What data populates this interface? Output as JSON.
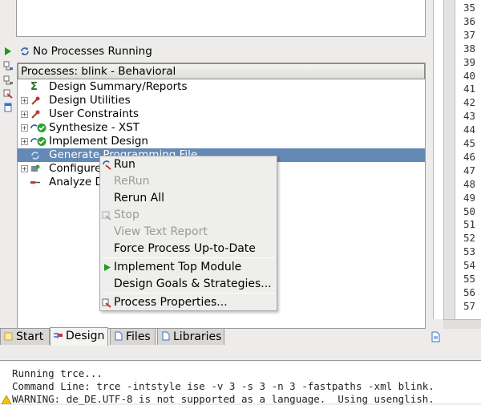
{
  "status": {
    "text": "No Processes Running"
  },
  "processes": {
    "header": "Processes: blink - Behavioral",
    "items": [
      {
        "label": "Design Summary/Reports"
      },
      {
        "label": "Design Utilities"
      },
      {
        "label": "User Constraints"
      },
      {
        "label": "Synthesize - XST"
      },
      {
        "label": "Implement Design"
      },
      {
        "label": "Generate Programming File"
      },
      {
        "label": "Configure Target Device"
      },
      {
        "label": "Analyze Design Using ChipScope"
      }
    ]
  },
  "context_menu": {
    "run": "Run",
    "rerun": "ReRun",
    "rerun_all": "Rerun All",
    "stop": "Stop",
    "view_text_report": "View Text Report",
    "force_uptodate": "Force Process Up-to-Date",
    "implement_top": "Implement Top Module",
    "design_goals": "Design Goals & Strategies...",
    "process_properties": "Process Properties..."
  },
  "tabs": {
    "start": "Start",
    "design": "Design",
    "files": "Files",
    "libraries": "Libraries"
  },
  "line_numbers": [
    "35",
    "36",
    "37",
    "38",
    "39",
    "40",
    "41",
    "42",
    "43",
    "44",
    "45",
    "46",
    "47",
    "48",
    "49",
    "50",
    "51",
    "52",
    "53",
    "54",
    "55",
    "56",
    "57"
  ],
  "console": {
    "line1": "Running trce...",
    "line2": "Command Line: trce -intstyle ise -v 3 -s 3 -n 3 -fastpaths -xml blink.",
    "line3": "WARNING: de_DE.UTF-8 is not supported as a language.  Using usenglish."
  },
  "colors": {
    "selection": "#6489b5",
    "success": "#2e9e2e",
    "run_arrow": "#1e9b1e"
  }
}
